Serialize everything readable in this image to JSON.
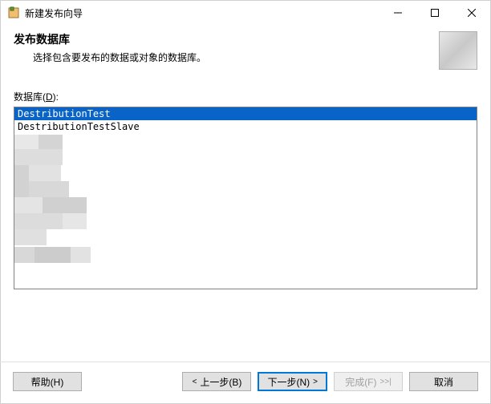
{
  "window": {
    "title": "新建发布向导"
  },
  "header": {
    "title": "发布数据库",
    "subtitle": "选择包含要发布的数据或对象的数据库。"
  },
  "field": {
    "label_pre": "数据库(",
    "label_hotkey": "D",
    "label_post": "):"
  },
  "databases": [
    {
      "name": "DestributionTest",
      "selected": true
    },
    {
      "name": "DestributionTestSlave",
      "selected": false
    }
  ],
  "buttons": {
    "help": "帮助(H)",
    "back": "上一步(B)",
    "next": "下一步(N)",
    "finish": "完成(F)",
    "cancel": "取消"
  },
  "chevrons": {
    "left": "<",
    "right": ">",
    "double_right": ">>|"
  }
}
